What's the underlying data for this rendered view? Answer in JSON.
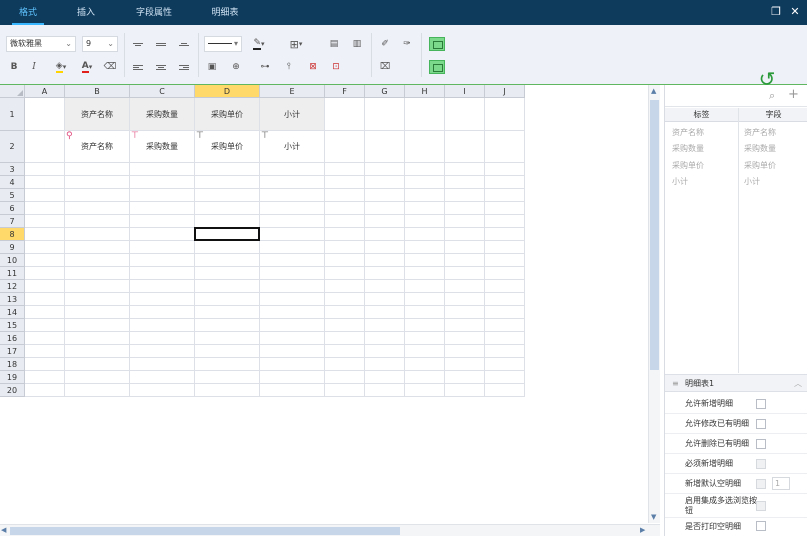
{
  "tabs": [
    {
      "label": "格式",
      "active": true
    },
    {
      "label": "插入",
      "active": false
    },
    {
      "label": "字段属性",
      "active": false
    },
    {
      "label": "明细表",
      "active": false
    }
  ],
  "window": {
    "restore_glyph": "❐",
    "close_glyph": "✕"
  },
  "toolbar": {
    "font_family": "微软雅黑",
    "font_size": "9",
    "bold": "B",
    "italic": "I",
    "back_label": "返回"
  },
  "grid": {
    "columns": [
      "A",
      "B",
      "C",
      "D",
      "E",
      "F",
      "G",
      "H",
      "I",
      "J"
    ],
    "rows": [
      "1",
      "2",
      "3",
      "4",
      "5",
      "6",
      "7",
      "8",
      "9",
      "10",
      "11",
      "12",
      "13",
      "14",
      "15",
      "16",
      "17",
      "18",
      "19",
      "20"
    ],
    "row1": [
      "",
      "资产名称",
      "采购数量",
      "采购单价",
      "小计",
      "",
      "",
      "",
      "",
      ""
    ],
    "row2": [
      "",
      "资产名称",
      "采购数量",
      "采购单价",
      "小计",
      "",
      "",
      "",
      "",
      ""
    ],
    "selected_cell": "D8"
  },
  "right_panel": {
    "col_label": "标签",
    "col_field": "字段",
    "labels": [
      "资产名称",
      "采购数量",
      "采购单价",
      "小计"
    ],
    "fields": [
      "资产名称",
      "采购数量",
      "采购单价"
    ],
    "section_title": "明细表1",
    "options": [
      {
        "label": "允许新增明细",
        "checked": false,
        "disabled": false
      },
      {
        "label": "允许修改已有明细",
        "checked": false,
        "disabled": false
      },
      {
        "label": "允许删除已有明细",
        "checked": false,
        "disabled": false
      },
      {
        "label": "必须新增明细",
        "checked": false,
        "disabled": true
      },
      {
        "label": "新增默认空明细",
        "checked": false,
        "disabled": true
      },
      {
        "label": "启用集成多选浏览按钮",
        "checked": false,
        "disabled": true
      },
      {
        "label": "是否打印空明细",
        "checked": false,
        "disabled": false
      }
    ],
    "default_empty_count": "1"
  },
  "colors": {
    "accent": "#38b6ff",
    "tabbar": "#0e3a5c",
    "selection": "#ffd96a",
    "green": "#7ad98a"
  }
}
